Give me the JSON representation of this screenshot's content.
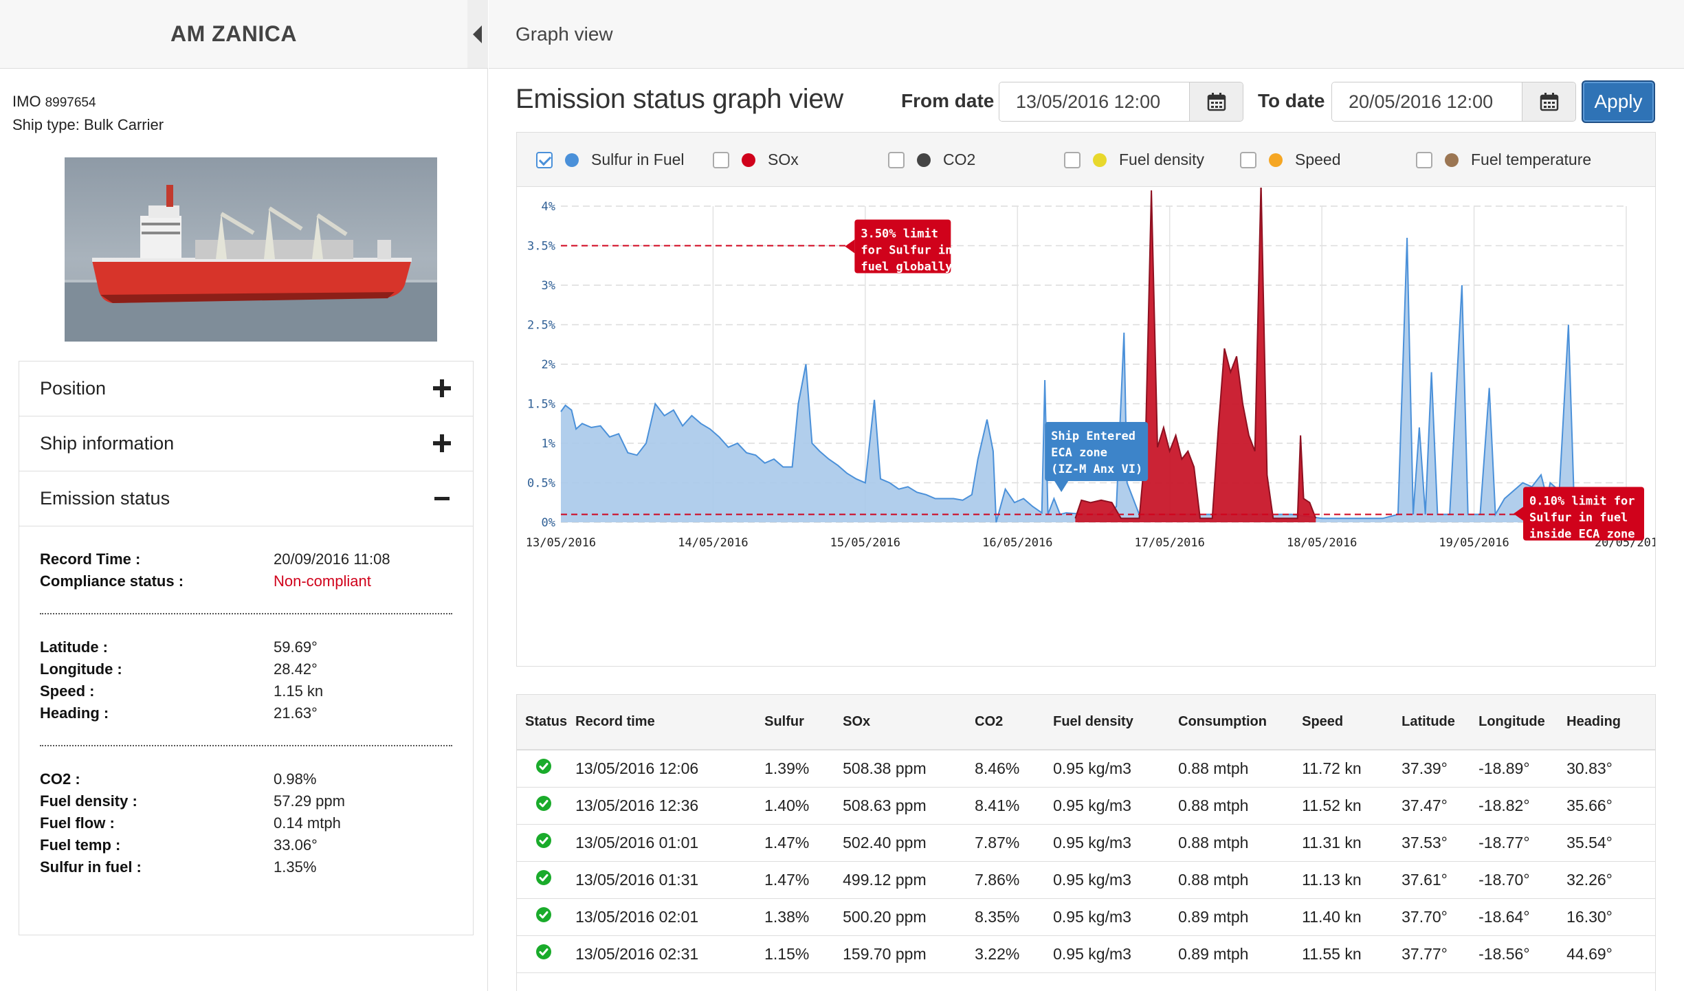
{
  "sidebar": {
    "ship_name": "AM ZANICA",
    "imo_label": "IMO",
    "imo_value": "8997654",
    "ship_type": "Ship type: Bulk Carrier",
    "sections": {
      "position": "Position",
      "ship_information": "Ship information",
      "emission_status": "Emission status"
    },
    "emission": {
      "record_time_label": "Record Time :",
      "record_time": "20/09/2016 11:08",
      "compliance_label": "Compliance status :",
      "compliance": "Non-compliant",
      "latitude_label": "Latitude :",
      "latitude": "59.69°",
      "longitude_label": "Longitude :",
      "longitude": "28.42°",
      "speed_label": "Speed :",
      "speed": "1.15 kn",
      "heading_label": "Heading :",
      "heading": "21.63°",
      "co2_label": "CO2 :",
      "co2": "0.98%",
      "fuel_density_label": "Fuel density :",
      "fuel_density": "57.29 ppm",
      "fuel_flow_label": "Fuel flow :",
      "fuel_flow": "0.14 mtph",
      "fuel_temp_label": "Fuel temp :",
      "fuel_temp": "33.06°",
      "sulfur_label": "Sulfur in fuel :",
      "sulfur": "1.35%"
    }
  },
  "main": {
    "header_title": "Graph view",
    "graph_title": "Emission status graph view",
    "from_label": "From date",
    "from_value": "13/05/2016 12:00",
    "to_label": "To date",
    "to_value": "20/05/2016 12:00",
    "apply_label": "Apply"
  },
  "legend": [
    {
      "label": "Sulfur in Fuel",
      "color": "#4a90d9",
      "checked": true
    },
    {
      "label": "SOx",
      "color": "#d0021b",
      "checked": false
    },
    {
      "label": "CO2",
      "color": "#444444",
      "checked": false
    },
    {
      "label": "Fuel density",
      "color": "#e8d82c",
      "checked": false
    },
    {
      "label": "Speed",
      "color": "#f5a623",
      "checked": false
    },
    {
      "label": "Fuel temperature",
      "color": "#9b7653",
      "checked": false
    }
  ],
  "annotations": {
    "global_limit": [
      "3.50% limit",
      "for Sulfur in",
      "fuel globally"
    ],
    "eca_entered": [
      "Ship Entered",
      "ECA zone",
      "(IZ-M Anx VI)"
    ],
    "eca_limit": [
      "0.10% limit for",
      "Sulfur in fuel",
      "inside ECA zone"
    ]
  },
  "chart_data": {
    "type": "area",
    "title": "",
    "xlabel": "",
    "ylabel": "",
    "x_ticks": [
      "13/05/2016",
      "14/05/2016",
      "15/05/2016",
      "16/05/2016",
      "17/05/2016",
      "18/05/2016",
      "19/05/2016",
      "20/05/201"
    ],
    "y_ticks": [
      "0%",
      "0.5%",
      "1%",
      "1.5%",
      "2%",
      "2.5%",
      "3%",
      "3.5%",
      "4%"
    ],
    "ylim": [
      0,
      4
    ],
    "grid": true,
    "reference_lines": [
      {
        "value": 3.5,
        "label": "3.50% limit for Sulfur in fuel globally"
      },
      {
        "value": 0.1,
        "label": "0.10% limit for Sulfur in fuel inside ECA zone"
      }
    ],
    "x_unit": "days since 13/05/2016",
    "series": [
      {
        "name": "Sulfur in Fuel",
        "color": "#4a90d9",
        "points": [
          [
            0,
            1.4
          ],
          [
            0.03,
            1.48
          ],
          [
            0.07,
            1.42
          ],
          [
            0.1,
            1.18
          ],
          [
            0.14,
            1.25
          ],
          [
            0.2,
            1.2
          ],
          [
            0.26,
            1.22
          ],
          [
            0.32,
            1.08
          ],
          [
            0.38,
            1.12
          ],
          [
            0.44,
            0.88
          ],
          [
            0.5,
            0.85
          ],
          [
            0.56,
            1.0
          ],
          [
            0.62,
            1.5
          ],
          [
            0.68,
            1.35
          ],
          [
            0.74,
            1.42
          ],
          [
            0.8,
            1.22
          ],
          [
            0.86,
            1.35
          ],
          [
            0.92,
            1.25
          ],
          [
            0.98,
            1.18
          ],
          [
            1.04,
            1.08
          ],
          [
            1.1,
            0.95
          ],
          [
            1.16,
            1.0
          ],
          [
            1.22,
            0.88
          ],
          [
            1.28,
            0.85
          ],
          [
            1.34,
            0.75
          ],
          [
            1.4,
            0.8
          ],
          [
            1.46,
            0.7
          ],
          [
            1.52,
            0.7
          ],
          [
            1.56,
            1.5
          ],
          [
            1.61,
            2.0
          ],
          [
            1.65,
            1.0
          ],
          [
            1.7,
            0.9
          ],
          [
            1.76,
            0.8
          ],
          [
            1.82,
            0.72
          ],
          [
            1.88,
            0.62
          ],
          [
            1.94,
            0.55
          ],
          [
            2.0,
            0.5
          ],
          [
            2.06,
            1.55
          ],
          [
            2.1,
            0.55
          ],
          [
            2.16,
            0.5
          ],
          [
            2.22,
            0.42
          ],
          [
            2.28,
            0.45
          ],
          [
            2.34,
            0.38
          ],
          [
            2.4,
            0.35
          ],
          [
            2.46,
            0.3
          ],
          [
            2.52,
            0.3
          ],
          [
            2.58,
            0.3
          ],
          [
            2.64,
            0.28
          ],
          [
            2.7,
            0.35
          ],
          [
            2.74,
            0.8
          ],
          [
            2.8,
            1.3
          ],
          [
            2.84,
            0.9
          ],
          [
            2.86,
            0
          ],
          [
            2.92,
            0.42
          ],
          [
            2.98,
            0.25
          ],
          [
            3.04,
            0.3
          ],
          [
            3.1,
            0.2
          ],
          [
            3.16,
            0.12
          ],
          [
            3.18,
            1.8
          ],
          [
            3.2,
            0.1
          ],
          [
            3.24,
            0.3
          ],
          [
            3.28,
            0.1
          ],
          [
            3.32,
            0.12
          ],
          [
            3.45,
            0.1
          ],
          [
            3.55,
            0.1
          ],
          [
            3.6,
            0.1
          ],
          [
            3.65,
            0.2
          ],
          [
            3.7,
            2.4
          ],
          [
            3.72,
            0.5
          ],
          [
            3.8,
            0.1
          ],
          [
            4.0,
            0.1
          ],
          [
            4.2,
            0.1
          ],
          [
            4.4,
            0.1
          ],
          [
            4.6,
            0.1
          ],
          [
            4.8,
            0.1
          ],
          [
            5.0,
            0.05
          ],
          [
            5.2,
            0.05
          ],
          [
            5.4,
            0.05
          ],
          [
            5.5,
            0.1
          ],
          [
            5.56,
            3.6
          ],
          [
            5.6,
            0.1
          ],
          [
            5.64,
            1.2
          ],
          [
            5.68,
            0.1
          ],
          [
            5.72,
            1.9
          ],
          [
            5.76,
            0.1
          ],
          [
            5.84,
            0.1
          ],
          [
            5.92,
            3.0
          ],
          [
            5.96,
            0.1
          ],
          [
            6.04,
            0.1
          ],
          [
            6.1,
            1.7
          ],
          [
            6.14,
            0.1
          ],
          [
            6.2,
            0.3
          ],
          [
            6.26,
            0.4
          ],
          [
            6.32,
            0.5
          ],
          [
            6.38,
            0.45
          ],
          [
            6.44,
            0.6
          ],
          [
            6.48,
            0.3
          ],
          [
            6.5,
            0.5
          ],
          [
            6.56,
            0.4
          ],
          [
            6.62,
            2.5
          ],
          [
            6.66,
            0.1
          ],
          [
            6.72,
            0.1
          ]
        ]
      },
      {
        "name": "SOx",
        "color": "#d0021b",
        "points": [
          [
            3.38,
            0.05
          ],
          [
            3.42,
            0.28
          ],
          [
            3.48,
            0.25
          ],
          [
            3.55,
            0.28
          ],
          [
            3.62,
            0.25
          ],
          [
            3.68,
            0.05
          ],
          [
            3.8,
            0.05
          ],
          [
            3.84,
            0.9
          ],
          [
            3.88,
            4.2
          ],
          [
            3.92,
            0.95
          ],
          [
            3.96,
            1.2
          ],
          [
            4.0,
            0.9
          ],
          [
            4.04,
            1.1
          ],
          [
            4.08,
            0.8
          ],
          [
            4.12,
            0.9
          ],
          [
            4.16,
            0.7
          ],
          [
            4.2,
            0.05
          ],
          [
            4.28,
            0.05
          ],
          [
            4.32,
            1.2
          ],
          [
            4.36,
            2.2
          ],
          [
            4.4,
            1.9
          ],
          [
            4.44,
            2.1
          ],
          [
            4.48,
            1.5
          ],
          [
            4.52,
            1.1
          ],
          [
            4.56,
            0.9
          ],
          [
            4.6,
            4.3
          ],
          [
            4.64,
            0.6
          ],
          [
            4.68,
            0.05
          ],
          [
            4.84,
            0.05
          ],
          [
            4.86,
            1.1
          ],
          [
            4.88,
            0.3
          ],
          [
            4.92,
            0.25
          ],
          [
            4.96,
            0.05
          ]
        ]
      }
    ]
  },
  "table": {
    "headers": [
      "Status",
      "Record time",
      "Sulfur",
      "SOx",
      "CO2",
      "Fuel density",
      "Consumption",
      "Speed",
      "Latitude",
      "Longitude",
      "Heading"
    ],
    "rows": [
      [
        "13/05/2016 12:06",
        "1.39%",
        "508.38 ppm",
        "8.46%",
        "0.95 kg/m3",
        "0.88 mtph",
        "11.72 kn",
        "37.39°",
        "-18.89°",
        "30.83°"
      ],
      [
        "13/05/2016 12:36",
        "1.40%",
        "508.63 ppm",
        "8.41%",
        "0.95 kg/m3",
        "0.88 mtph",
        "11.52 kn",
        "37.47°",
        "-18.82°",
        "35.66°"
      ],
      [
        "13/05/2016 01:01",
        "1.47%",
        "502.40 ppm",
        "7.87%",
        "0.95 kg/m3",
        "0.88 mtph",
        "11.31 kn",
        "37.53°",
        "-18.77°",
        "35.54°"
      ],
      [
        "13/05/2016 01:31",
        "1.47%",
        "499.12 ppm",
        "7.86%",
        "0.95 kg/m3",
        "0.88 mtph",
        "11.13 kn",
        "37.61°",
        "-18.70°",
        "32.26°"
      ],
      [
        "13/05/2016 02:01",
        "1.38%",
        "500.20 ppm",
        "8.35%",
        "0.95 kg/m3",
        "0.89 mtph",
        "11.40 kn",
        "37.70°",
        "-18.64°",
        "16.30°"
      ],
      [
        "13/05/2016 02:31",
        "1.15%",
        "159.70 ppm",
        "3.22%",
        "0.95 kg/m3",
        "0.89 mtph",
        "11.55 kn",
        "37.77°",
        "-18.56°",
        "44.69°"
      ]
    ]
  },
  "colors": {
    "accent": "#2f73b6",
    "status_ok": "#1aab2b",
    "non_compliant": "#d0021b"
  }
}
